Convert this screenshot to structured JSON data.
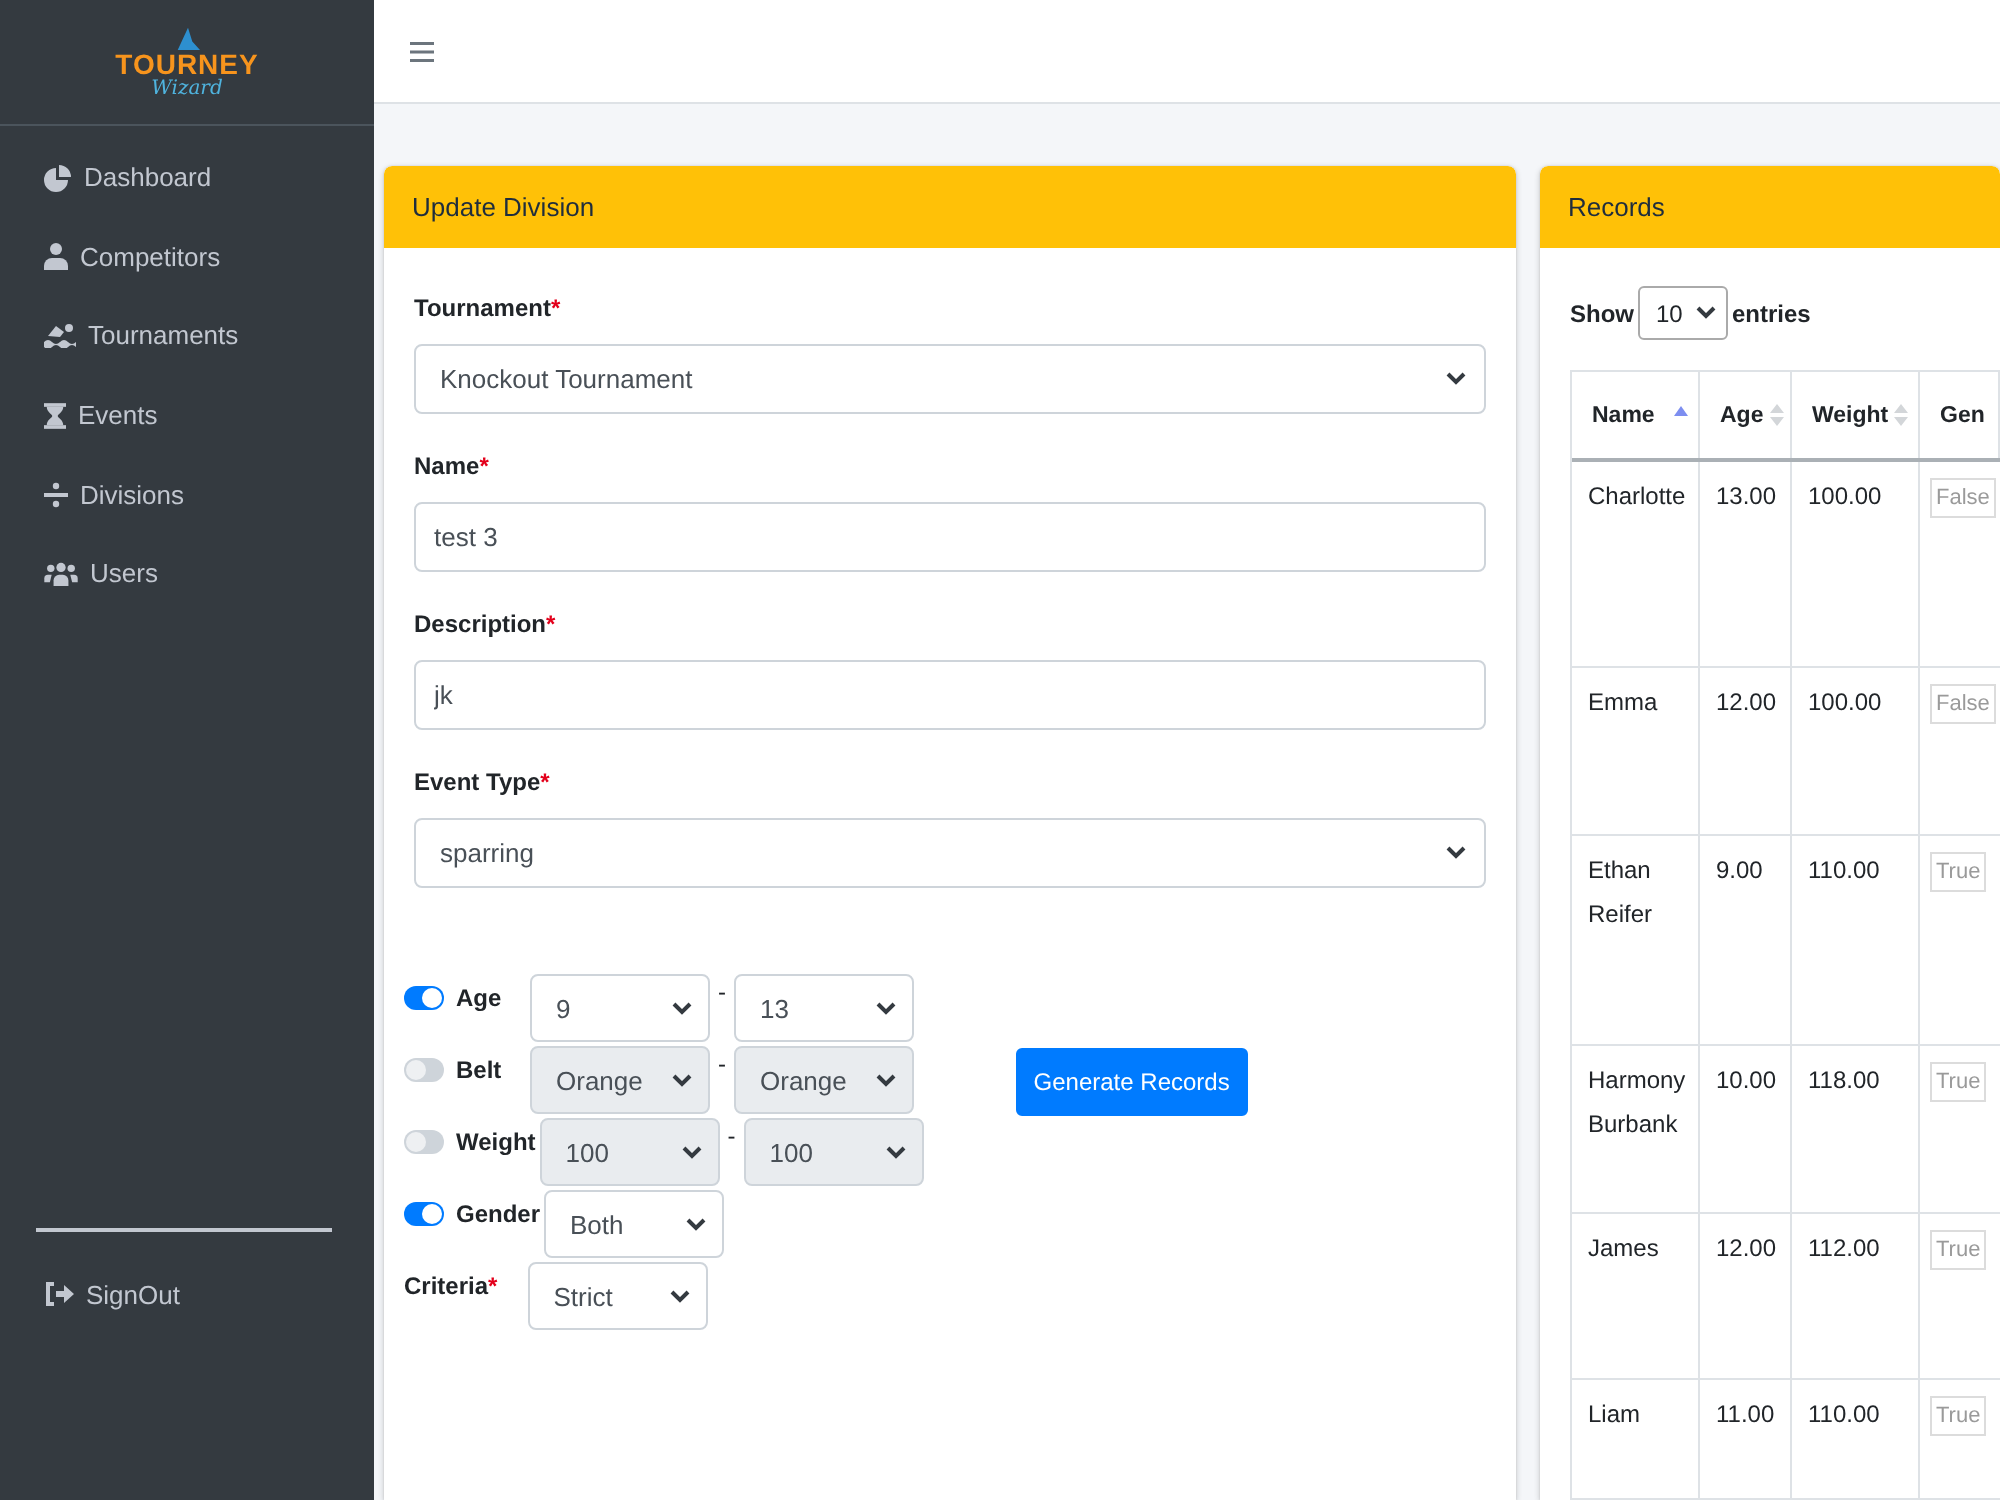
{
  "sidebar": {
    "logo": {
      "wordmark": "TOURNEY",
      "script": "Wizard"
    },
    "items": [
      {
        "label": "Dashboard"
      },
      {
        "label": "Competitors"
      },
      {
        "label": "Tournaments"
      },
      {
        "label": "Events"
      },
      {
        "label": "Divisions"
      },
      {
        "label": "Users"
      }
    ],
    "footer_items": [
      {
        "label": "SignOut"
      }
    ]
  },
  "update_division": {
    "title": "Update Division",
    "fields": [
      {
        "kind": "select",
        "label": "Tournament",
        "required_mark": "*",
        "value": "Knockout Tournament"
      },
      {
        "kind": "text",
        "label": "Name",
        "required_mark": "*",
        "value": "test 3"
      },
      {
        "kind": "text",
        "label": "Description",
        "required_mark": "*",
        "value": "jk"
      },
      {
        "kind": "select",
        "label": "Event Type",
        "required_mark": "*",
        "value": "sparring"
      }
    ],
    "filters": [
      {
        "kind": "range",
        "label": "Age",
        "on": true,
        "from": "9",
        "separator": "-",
        "to": "13"
      },
      {
        "kind": "range",
        "label": "Belt",
        "on": false,
        "from": "Orange",
        "separator": "-",
        "to": "Orange"
      },
      {
        "kind": "range",
        "label": "Weight",
        "on": false,
        "from": "100",
        "separator": "-",
        "to": "100"
      },
      {
        "kind": "single",
        "label": "Gender",
        "on": true,
        "value": "Both"
      }
    ],
    "criteria": {
      "label": "Criteria",
      "required_mark": "*",
      "value": "Strict"
    },
    "generate_button": "Generate Records"
  },
  "records": {
    "title": "Records",
    "length_menu": {
      "before": "Show",
      "value": "10",
      "after": "entries"
    },
    "table": {
      "columns": [
        {
          "kind": "text",
          "label": "Name",
          "sorted": true
        },
        {
          "kind": "text",
          "label": "Age",
          "sorted": false
        },
        {
          "kind": "text",
          "label": "Weight",
          "sorted": false
        },
        {
          "kind": "field",
          "label": "Gen"
        }
      ],
      "rows": [
        {
          "cells": [
            "Charlotte",
            "13.00",
            "100.00",
            "False"
          ]
        },
        {
          "cells": [
            "Emma",
            "12.00",
            "100.00",
            "False"
          ]
        },
        {
          "cells": [
            "Ethan Reifer",
            "9.00",
            "110.00",
            "True"
          ]
        },
        {
          "cells": [
            "Harmony Burbank",
            "10.00",
            "118.00",
            "True"
          ]
        },
        {
          "cells": [
            "James",
            "12.00",
            "112.00",
            "True"
          ]
        },
        {
          "cells": [
            "Liam",
            "11.00",
            "110.00",
            "True"
          ]
        }
      ]
    }
  }
}
